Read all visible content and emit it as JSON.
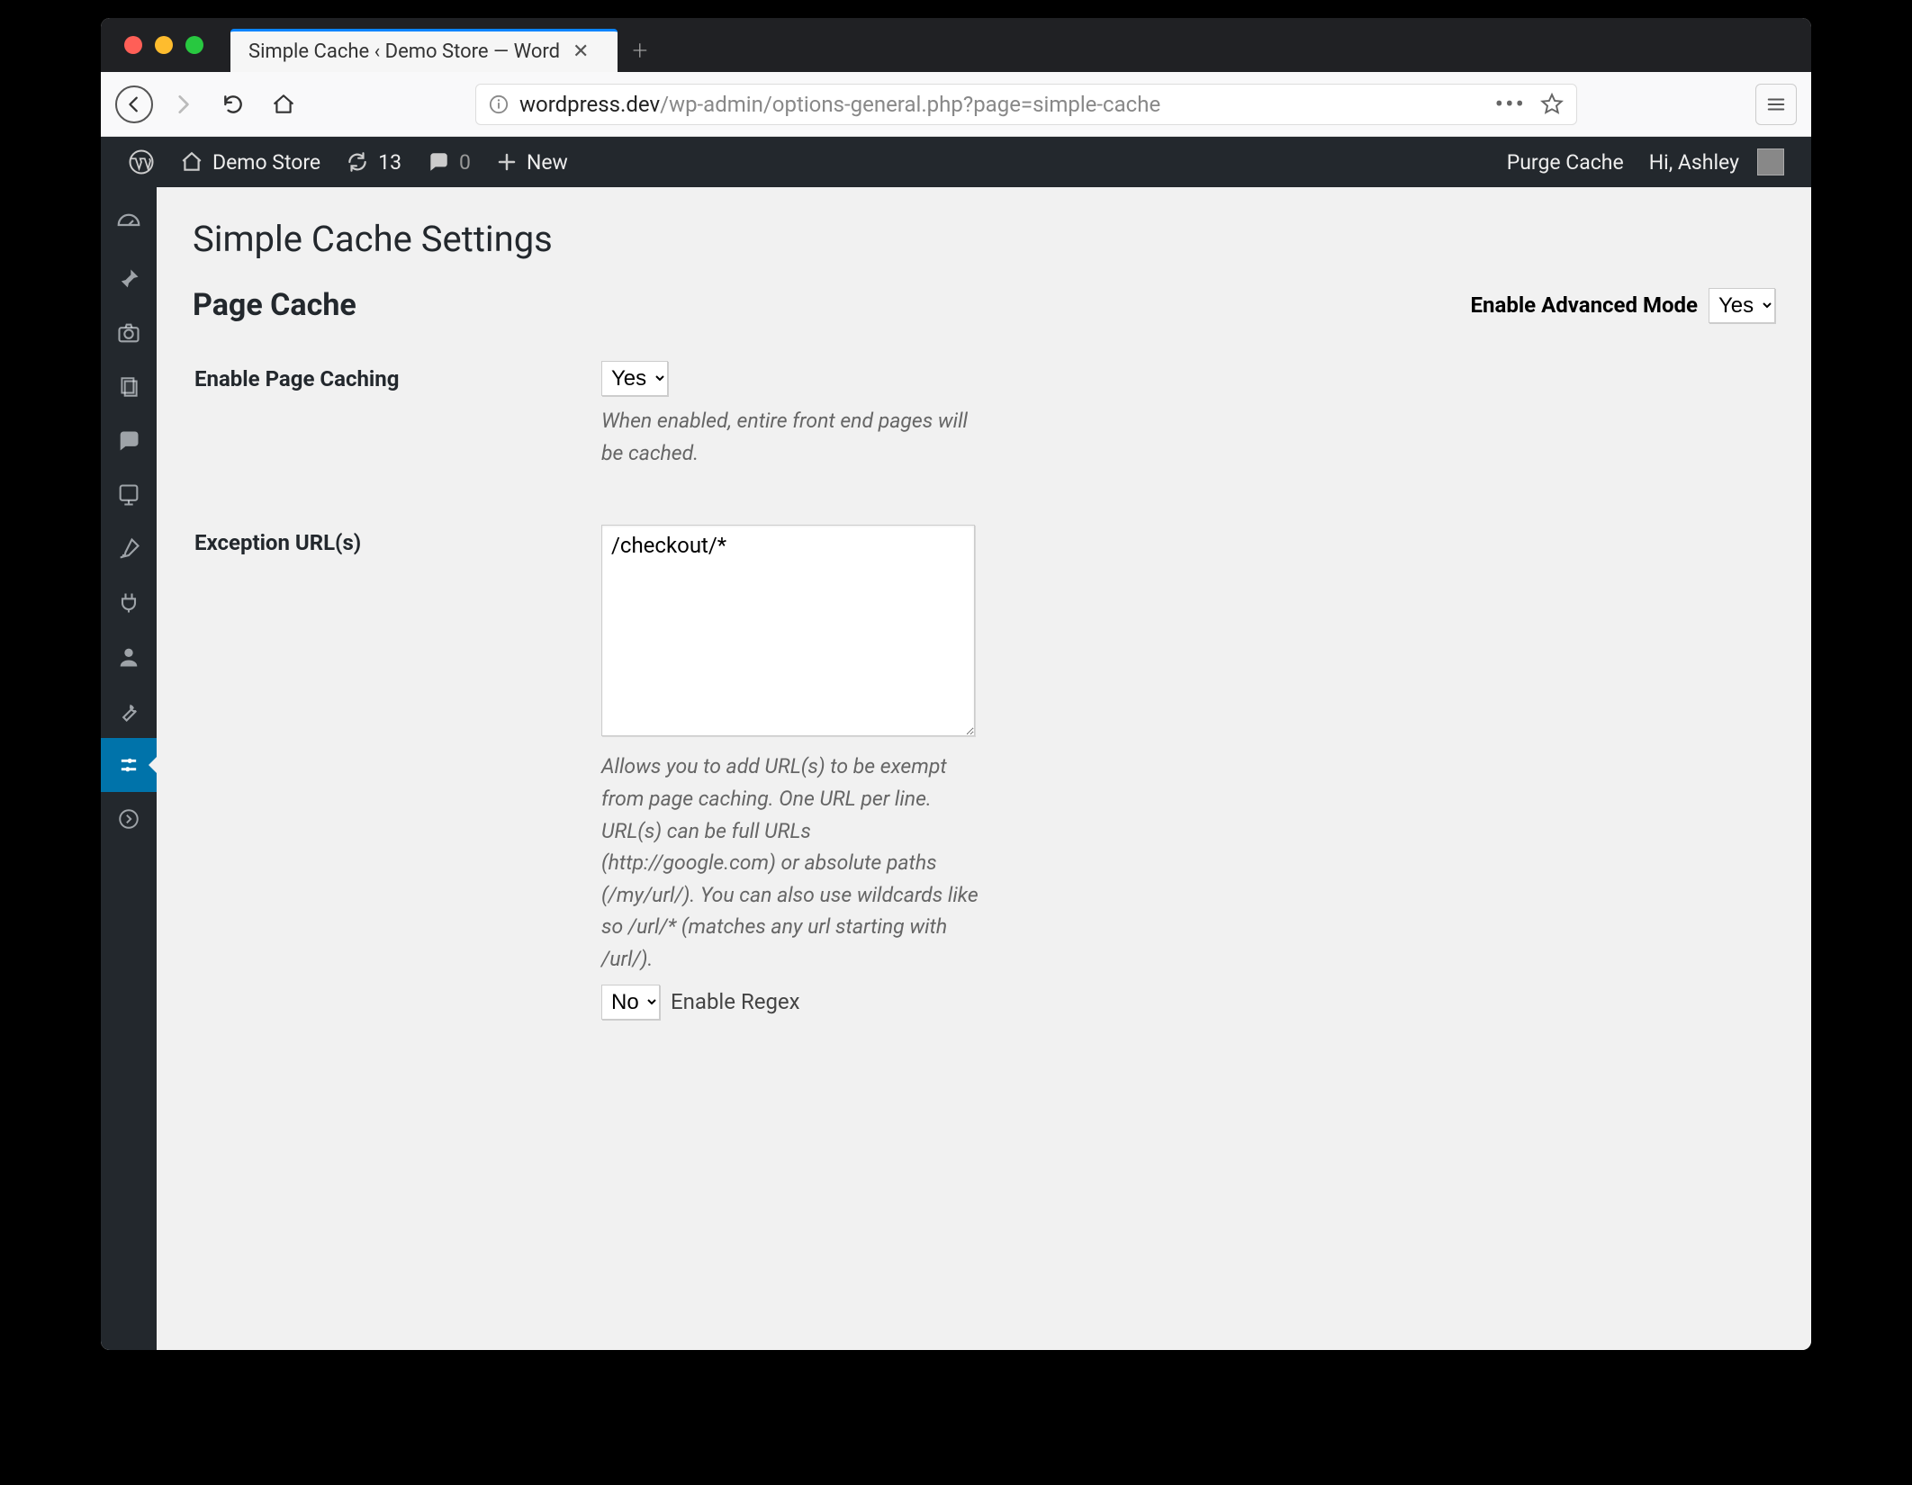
{
  "browser": {
    "tab_title": "Simple Cache ‹ Demo Store — Word",
    "url_domain": "wordpress.dev",
    "url_path": "/wp-admin/options-general.php?page=simple-cache"
  },
  "adminbar": {
    "site_name": "Demo Store",
    "updates_count": "13",
    "comments_count": "0",
    "new_label": "New",
    "purge_label": "Purge Cache",
    "greeting": "Hi, Ashley"
  },
  "page": {
    "title": "Simple Cache Settings",
    "section_heading": "Page Cache",
    "advanced_mode_label": "Enable Advanced Mode",
    "advanced_mode_value": "Yes",
    "fields": {
      "enable_caching": {
        "label": "Enable Page Caching",
        "value": "Yes",
        "description": "When enabled, entire front end pages will be cached."
      },
      "exception_urls": {
        "label": "Exception URL(s)",
        "value": "/checkout/*",
        "description": "Allows you to add URL(s) to be exempt from page caching. One URL per line. URL(s) can be full URLs (http://google.com) or absolute paths (/my/url/). You can also use wildcards like so /url/* (matches any url starting with /url/).",
        "regex_value": "No",
        "regex_label": "Enable Regex"
      }
    }
  }
}
